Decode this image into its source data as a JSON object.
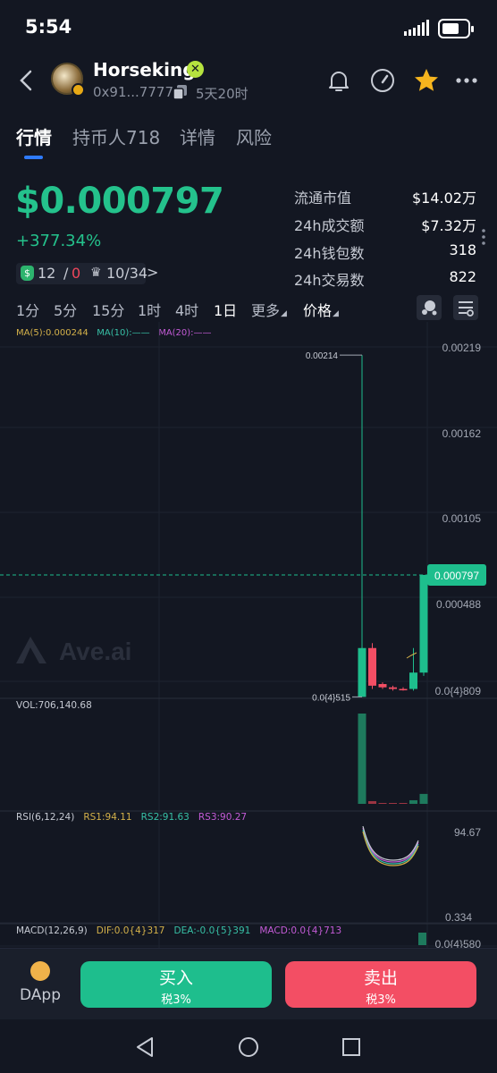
{
  "status_bar": {
    "time": "5:54"
  },
  "header": {
    "token_name": "Horseking",
    "address": "0x91...7777",
    "age": "5天20时"
  },
  "tabs": [
    {
      "label": "行情"
    },
    {
      "label": "持币人718"
    },
    {
      "label": "详情"
    },
    {
      "label": "风险"
    }
  ],
  "price": {
    "value": "$0.000797",
    "change": "+377.34%",
    "buyers": "12",
    "sep": "/",
    "sellers": "0",
    "rank": "10/34",
    "arrow": ">"
  },
  "stats": [
    {
      "label": "流通市值",
      "value": "$14.02万"
    },
    {
      "label": "24h成交额",
      "value": "$7.32万"
    },
    {
      "label": "24h钱包数",
      "value": "318"
    },
    {
      "label": "24h交易数",
      "value": "822"
    }
  ],
  "intervals": [
    "1分",
    "5分",
    "15分",
    "1时",
    "4时",
    "1日",
    "更多",
    "价格"
  ],
  "active_interval": "1日",
  "chart": {
    "ma_labels": [
      "MA(5):0.000244",
      "MA(10):——",
      "MA(20):——"
    ],
    "ma_colors": [
      "#d4b14a",
      "#37c0a6",
      "#c35bd6"
    ],
    "watermark": "Ave.ai",
    "price_axis": [
      "0.00219",
      "0.00162",
      "0.00105",
      "0.000488",
      "0.0{4}809"
    ],
    "current_price_tag": "0.000797",
    "high_label": "0.00214",
    "low_label": "0.0{4}515",
    "vol_label": "VOL:706,140.68",
    "rsi_labels": [
      "RSI(6,12,24)",
      "RS1:94.11",
      "RS2:91.63",
      "RS3:90.27"
    ],
    "rsi_colors": [
      "#c7cbd4",
      "#d4b14a",
      "#37c0a6",
      "#c35bd6"
    ],
    "rsi_axis": [
      "94.67",
      "0.334"
    ],
    "macd_labels": [
      "MACD(12,26,9)",
      "DIF:0.0{4}317",
      "DEA:-0.0{5}391",
      "MACD:0.0{4}713"
    ],
    "macd_colors": [
      "#c7cbd4",
      "#d4b14a",
      "#37c0a6",
      "#c35bd6"
    ],
    "macd_axis": "0.0{4}580"
  },
  "chart_data": {
    "type": "candlestick",
    "candles": [
      {
        "open": 5.15e-05,
        "close": 0.00035,
        "high": 0.00214,
        "low": 5.15e-05,
        "color": "up"
      },
      {
        "open": 0.00035,
        "close": 0.00012,
        "high": 0.00038,
        "low": 0.0001,
        "color": "down"
      },
      {
        "open": 0.00013,
        "close": 0.00011,
        "high": 0.00014,
        "low": 0.0001,
        "color": "down"
      },
      {
        "open": 0.00011,
        "close": 0.0001,
        "high": 0.00012,
        "low": 9e-05,
        "color": "down"
      },
      {
        "open": 0.0001,
        "close": 9.5e-05,
        "high": 0.00011,
        "low": 9e-05,
        "color": "down"
      },
      {
        "open": 0.0001,
        "close": 0.0002,
        "high": 0.00035,
        "low": 9e-05,
        "color": "up"
      },
      {
        "open": 0.0002,
        "close": 0.000797,
        "high": 0.000797,
        "low": 0.00018,
        "color": "up"
      }
    ],
    "volume": [
      100,
      3,
      1,
      0.5,
      0.5,
      4,
      11
    ],
    "price_range": [
      8.09e-05,
      0.00219
    ],
    "current_price": 0.000797
  },
  "bottom": {
    "dapp_label": "DApp",
    "buy_label": "买入",
    "buy_tax": "税3%",
    "sell_label": "卖出",
    "sell_tax": "税3%"
  }
}
